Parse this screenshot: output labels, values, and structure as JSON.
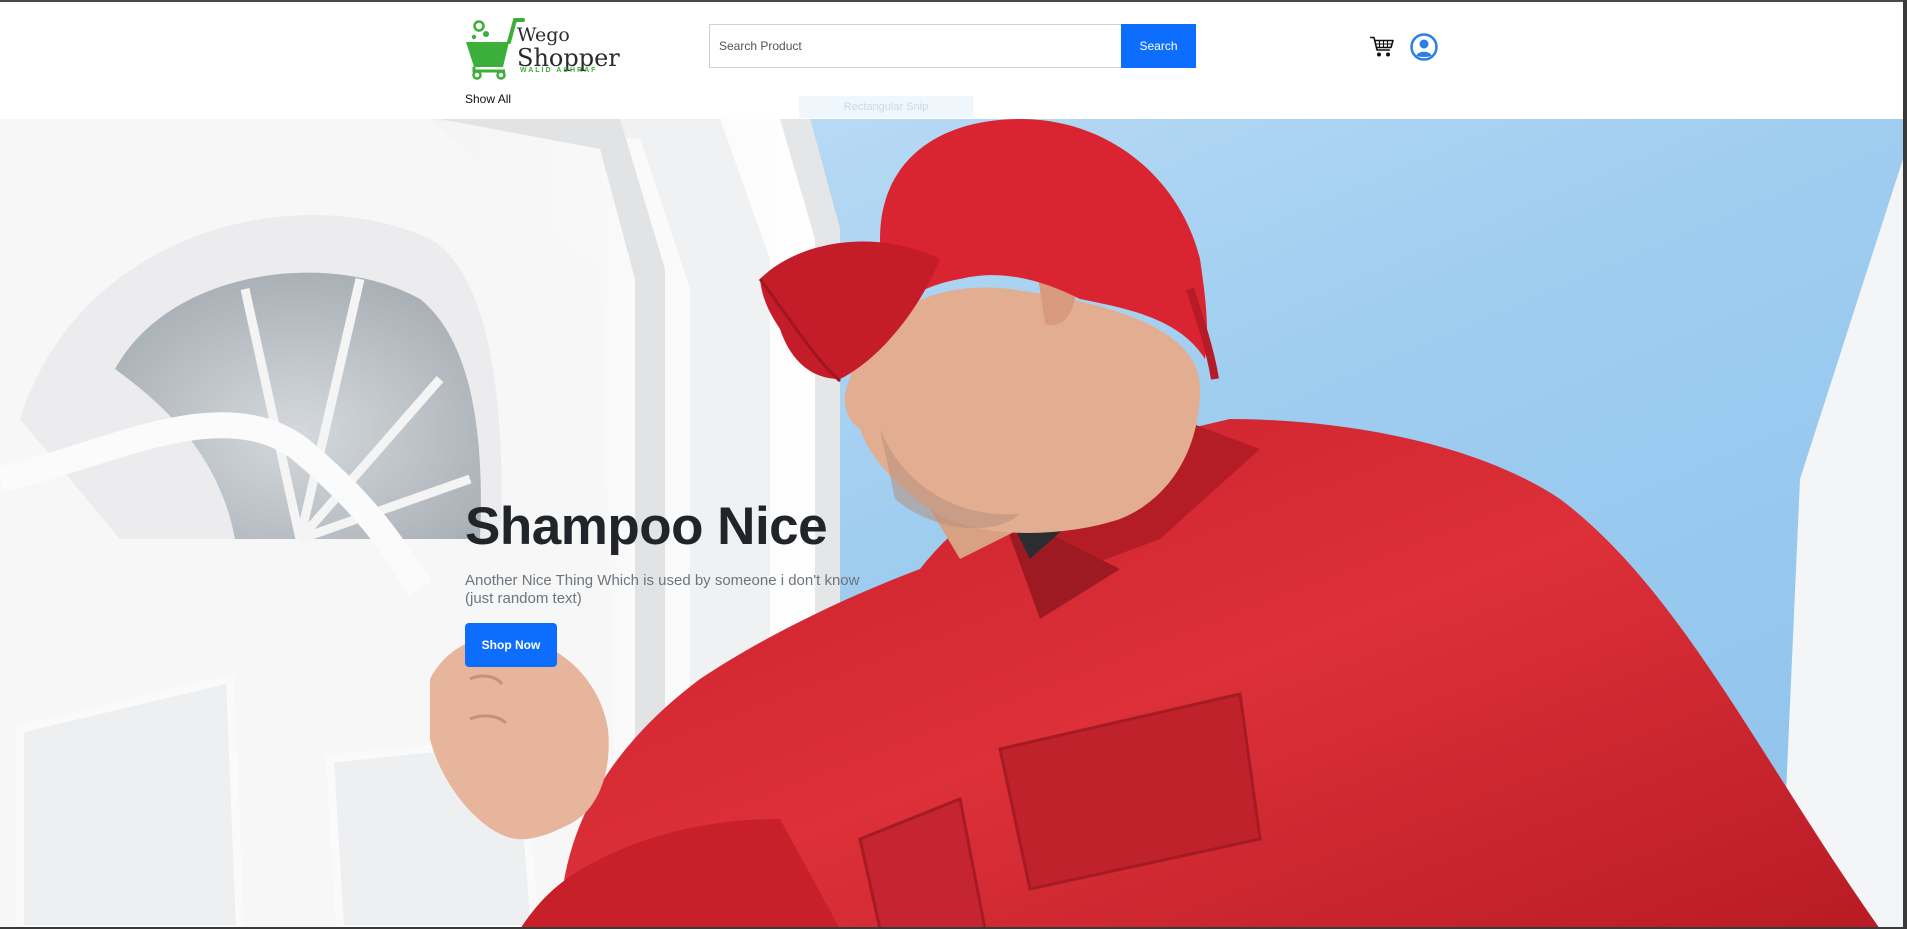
{
  "brand": {
    "name_line1": "Wego",
    "name_line2": "Shopper",
    "tagline": "WALID ASHRAF",
    "accent_color": "#3cae3a"
  },
  "search": {
    "placeholder": "Search Product",
    "value": "",
    "button_label": "Search"
  },
  "header_icons": {
    "cart": "cart-icon",
    "user": "user-profile-icon"
  },
  "nav": {
    "show_all_label": "Show All"
  },
  "overlay": {
    "snip_label": "Rectangular Snip"
  },
  "hero": {
    "title": "Shampoo Nice",
    "subtitle": "Another Nice Thing Which is used by someone i don't know (just random text)",
    "button_label": "Shop Now"
  },
  "colors": {
    "primary": "#0d6efd",
    "text_dark": "#212529",
    "text_muted": "#6c757d",
    "jacket_red": "#d92d35",
    "sky_blue": "#9fcdf0"
  }
}
